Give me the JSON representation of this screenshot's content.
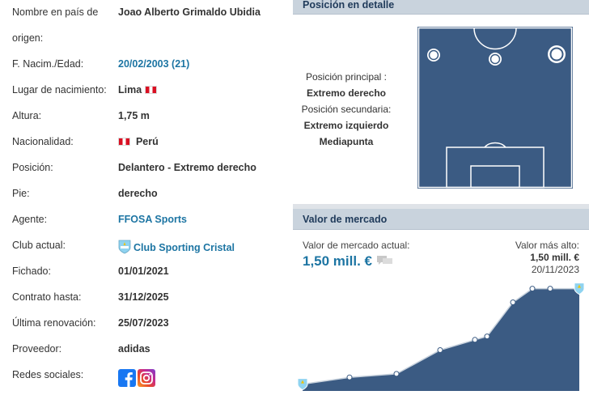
{
  "profile": {
    "name_label": "Nombre en país de",
    "name_label_cont": "origen:",
    "name_value": "Joao Alberto Grimaldo Ubidia",
    "birth_label": "F. Nacim./Edad:",
    "birth_value": "20/02/2003 (21)",
    "place_label": "Lugar de nacimiento:",
    "place_value": "Lima",
    "height_label": "Altura:",
    "height_value": "1,75 m",
    "nationality_label": "Nacionalidad:",
    "nationality_value": "Perú",
    "position_label": "Posición:",
    "position_value": "Delantero - Extremo derecho",
    "foot_label": "Pie:",
    "foot_value": "derecho",
    "agent_label": "Agente:",
    "agent_value": "FFOSA Sports",
    "club_label": "Club actual:",
    "club_value": "Club Sporting Cristal",
    "joined_label": "Fichado:",
    "joined_value": "01/01/2021",
    "contract_label": "Contrato hasta:",
    "contract_value": "31/12/2025",
    "renewal_label": "Última renovación:",
    "renewal_value": "25/07/2023",
    "supplier_label": "Proveedor:",
    "supplier_value": "adidas",
    "social_label": "Redes sociales:",
    "social_icons": [
      "facebook-icon",
      "instagram-icon"
    ]
  },
  "position_detail": {
    "header": "Posición en detalle",
    "main_label": "Posición principal :",
    "main_value": "Extremo derecho",
    "secondary_label": "Posición secundaria:",
    "secondary_values": [
      "Extremo izquierdo",
      "Mediapunta"
    ]
  },
  "market_value": {
    "header": "Valor de mercado",
    "current_label": "Valor de mercado actual:",
    "current_value": "1,50 mill. €",
    "max_label": "Valor más alto:",
    "max_value": "1,50 mill. €",
    "max_date": "20/11/2023"
  },
  "chart_data": {
    "type": "area",
    "values": [
      0.1,
      0.2,
      0.25,
      0.6,
      0.75,
      0.8,
      1.3,
      1.5,
      1.5,
      1.5
    ],
    "series_color": "#3b5b83",
    "ylim": [
      0,
      1.65
    ]
  },
  "colors": {
    "link": "#1d75a3",
    "header_bg": "#c9d3dd",
    "pitch": "#3b5b83"
  }
}
